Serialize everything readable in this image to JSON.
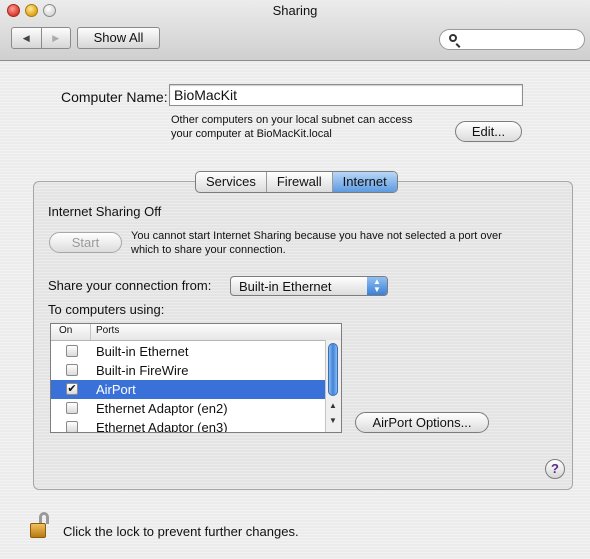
{
  "window": {
    "title": "Sharing"
  },
  "toolbar": {
    "back_icon": "◀",
    "forward_icon": "▶",
    "show_all_label": "Show All",
    "search_placeholder": ""
  },
  "computer": {
    "name_label": "Computer Name:",
    "name_value": "BioMacKit",
    "info_line1": "Other computers on your local subnet can access",
    "info_line2": "your computer at BioMacKit.local",
    "edit_label": "Edit..."
  },
  "tabs": [
    {
      "label": "Services",
      "active": false
    },
    {
      "label": "Firewall",
      "active": false
    },
    {
      "label": "Internet",
      "active": true
    }
  ],
  "internet": {
    "status": "Internet Sharing Off",
    "start_label": "Start",
    "start_note_line1": "You cannot start Internet Sharing because you have not selected a port over",
    "start_note_line2": "which to share your connection.",
    "share_from_label": "Share your connection from:",
    "share_from_value": "Built-in Ethernet",
    "to_computers_label": "To computers using:",
    "table": {
      "col_on": "On",
      "col_ports": "Ports",
      "rows": [
        {
          "on": false,
          "port": "Built-in Ethernet",
          "selected": false
        },
        {
          "on": false,
          "port": "Built-in FireWire",
          "selected": false
        },
        {
          "on": true,
          "port": "AirPort",
          "selected": true
        },
        {
          "on": false,
          "port": "Ethernet Adaptor (en2)",
          "selected": false
        },
        {
          "on": false,
          "port": "Ethernet Adaptor (en3)",
          "selected": false
        }
      ]
    },
    "airport_options_label": "AirPort Options..."
  },
  "help": {
    "label": "?"
  },
  "footer": {
    "lock_text": "Click the lock to prevent further changes."
  },
  "colors": {
    "selection": "#3a71d9",
    "tab_active": "#5e9ae0"
  }
}
